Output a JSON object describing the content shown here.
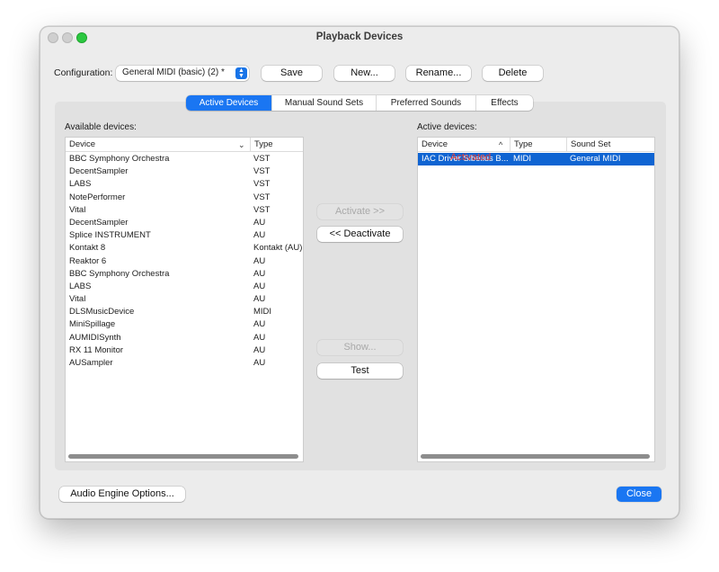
{
  "window": {
    "title": "Playback Devices"
  },
  "config": {
    "label": "Configuration:",
    "selected": "General MIDI (basic) (2) *",
    "stepper_glyph": "▲▼"
  },
  "toolbar": {
    "save": "Save",
    "new": "New...",
    "rename": "Rename...",
    "delete": "Delete"
  },
  "tabs": [
    "Active Devices",
    "Manual Sound Sets",
    "Preferred Sounds",
    "Effects"
  ],
  "active_tab": "Active Devices",
  "available": {
    "label": "Available devices:",
    "columns": [
      "Device",
      "Type"
    ],
    "sort_glyph": "⌄",
    "rows": [
      [
        "BBC Symphony Orchestra",
        "VST"
      ],
      [
        "DecentSampler",
        "VST"
      ],
      [
        "LABS",
        "VST"
      ],
      [
        "NotePerformer",
        "VST"
      ],
      [
        "Vital",
        "VST"
      ],
      [
        "DecentSampler",
        "AU"
      ],
      [
        "Splice INSTRUMENT",
        "AU"
      ],
      [
        "Kontakt 8",
        "Kontakt (AU)"
      ],
      [
        "Reaktor 6",
        "AU"
      ],
      [
        "BBC Symphony Orchestra",
        "AU"
      ],
      [
        "LABS",
        "AU"
      ],
      [
        "Vital",
        "AU"
      ],
      [
        "DLSMusicDevice",
        "MIDI"
      ],
      [
        "MiniSpillage",
        "AU"
      ],
      [
        "AUMIDISynth",
        "AU"
      ],
      [
        "RX 11 Monitor",
        "AU"
      ],
      [
        "AUSampler",
        "AU"
      ]
    ]
  },
  "middle": {
    "activate": "Activate >>",
    "deactivate": "<< Deactivate",
    "show": "Show...",
    "test": "Test"
  },
  "active": {
    "label": "Active devices:",
    "columns": [
      "Device",
      "Type",
      "Sound Set"
    ],
    "sort_glyph": "^",
    "rows": [
      [
        "IAC Driver Sibelius B...",
        "MIDI",
        "General MIDI"
      ]
    ],
    "status_note": "Activated",
    "status_color": "#e2403c"
  },
  "footer": {
    "audio_engine": "Audio Engine Options...",
    "close": "Close"
  },
  "colors": {
    "accent": "#1a76f2",
    "selection": "#0f64d2"
  }
}
